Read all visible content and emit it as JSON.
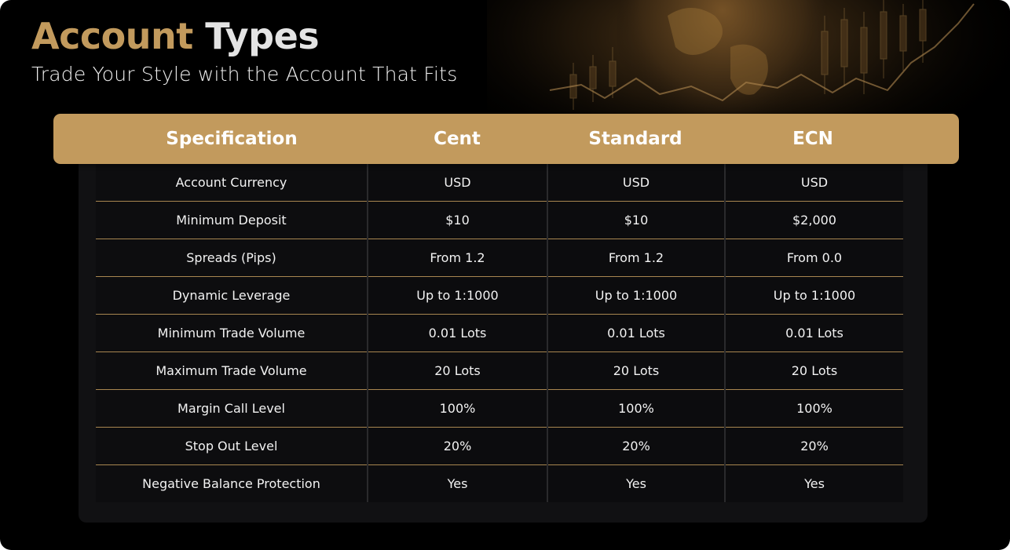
{
  "header": {
    "title_word1": "Account",
    "title_word2": "Types",
    "subtitle": "Trade Your Style with the Account That Fits"
  },
  "colors": {
    "accent_gold": "#c29a5d",
    "background": "#000000",
    "panel": "#111113"
  },
  "table": {
    "columns": [
      "Specification",
      "Cent",
      "Standard",
      "ECN"
    ],
    "rows": [
      [
        "Account Currency",
        "USD",
        "USD",
        "USD"
      ],
      [
        "Minimum Deposit",
        "$10",
        "$10",
        "$2,000"
      ],
      [
        "Spreads (Pips)",
        "From 1.2",
        "From 1.2",
        "From 0.0"
      ],
      [
        "Dynamic Leverage",
        "Up to 1:1000",
        "Up to 1:1000",
        "Up to 1:1000"
      ],
      [
        "Minimum Trade Volume",
        "0.01 Lots",
        "0.01 Lots",
        "0.01 Lots"
      ],
      [
        "Maximum Trade Volume",
        "20 Lots",
        "20 Lots",
        "20 Lots"
      ],
      [
        "Margin Call Level",
        "100%",
        "100%",
        "100%"
      ],
      [
        "Stop Out Level",
        "20%",
        "20%",
        "20%"
      ],
      [
        "Negative Balance Protection",
        "Yes",
        "Yes",
        "Yes"
      ]
    ]
  }
}
